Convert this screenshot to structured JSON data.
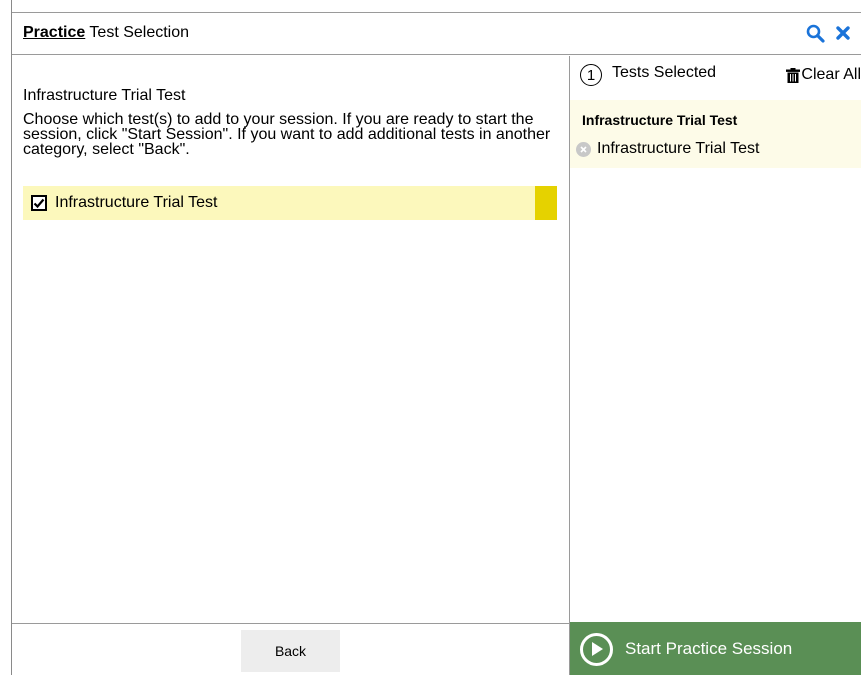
{
  "header": {
    "title_bold": "Practice",
    "title_rest": " Test Selection",
    "search_icon": "search-icon",
    "close_icon": "close-icon"
  },
  "left": {
    "test_heading": "Infrastructure Trial Test",
    "instructions": "Choose which test(s) to add to your session. If you are ready to start the session, click \"Start Session\". If you want to add additional tests in another category, select \"Back\".",
    "tests": [
      {
        "label": "Infrastructure Trial Test",
        "checked": true
      }
    ]
  },
  "right": {
    "count": "1",
    "selected_label": "Tests Selected",
    "clear_all": "Clear All",
    "group_title": "Infrastructure Trial Test",
    "items": [
      {
        "label": "Infrastructure Trial Test"
      }
    ]
  },
  "footer": {
    "back": "Back",
    "start": "Start Practice Session"
  },
  "colors": {
    "accent_blue": "#1a73d9",
    "row_highlight": "#fcf8bc",
    "row_marker": "#e5d200",
    "start_green": "#5a8f55"
  }
}
